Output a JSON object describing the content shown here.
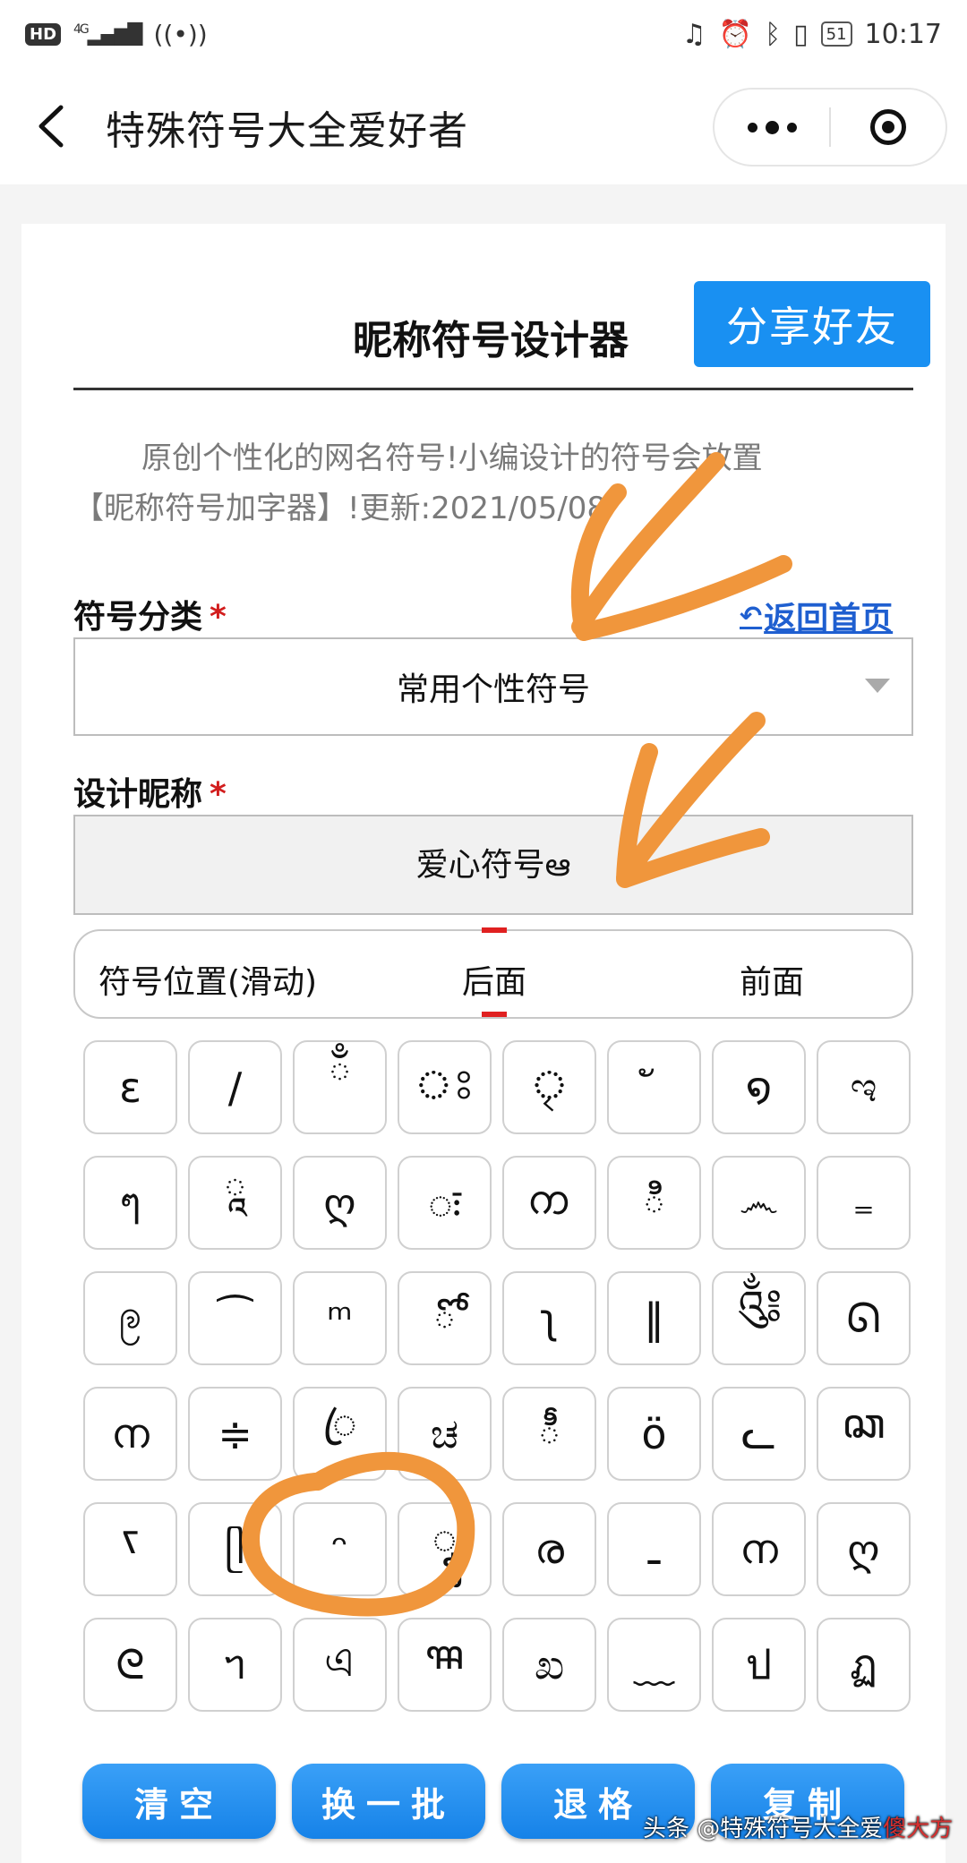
{
  "status_bar": {
    "hd": "HD",
    "net": "4G",
    "battery": "51",
    "time": "10:17"
  },
  "nav": {
    "title": "特殊符号大全爱好者"
  },
  "page": {
    "title": "昵称符号设计器",
    "share_label": "分享好友",
    "intro_line1": "原创个性化的网名符号!小编设计的符号会放置",
    "intro_line2": "【昵称符号加字器】!更新:2021/05/08"
  },
  "form": {
    "category_label": "符号分类",
    "required_mark": "*",
    "home_link": "返回首页",
    "category_value": "常用个性符号",
    "nickname_label": "设计昵称",
    "nickname_value": "爱心符号ఆ",
    "position_label": "符号位置(滑动)",
    "position_options": [
      "后面",
      "前面"
    ],
    "position_selected": "后面"
  },
  "symbols": [
    [
      "ɛ",
      "/",
      "ྃ",
      "ঃ",
      "ৃ",
      "ั",
      "໑",
      "ಇ"
    ],
    [
      "ๆ",
      "ཱ",
      "ღ",
      "ः",
      "ᨠ",
      "ి",
      "෴",
      "₌"
    ],
    [
      "ဨ",
      "⁀",
      "ᵐ",
      "ో",
      "ʅ",
      "‖",
      "༃",
      "ᘏ"
    ],
    [
      "ന",
      "≑",
      "ꦿ",
      "ಚ",
      "ీ",
      "ö",
      "ᓚ",
      "ꦕ"
    ],
    [
      "ꧏ",
      "ᥫ",
      "ᵔ",
      "ꦹ",
      "ര",
      "ـ",
      "ന",
      "ღ"
    ],
    [
      "ᘓ",
      "ᥐ",
      "এ",
      "ꦯ",
      "ಖ",
      "﹏",
      "ป",
      "ฏ"
    ]
  ],
  "buttons": {
    "clear": "清空",
    "shuffle": "换一批",
    "backspace": "退格",
    "copy": "复制"
  },
  "watermark": {
    "prefix": "头条 @特殊符号大全爱",
    "brand": "傻大方"
  },
  "colors": {
    "accent": "#1990f2",
    "required": "#d21d1d",
    "link": "#1f5fd0",
    "annotation": "#f0963c"
  }
}
